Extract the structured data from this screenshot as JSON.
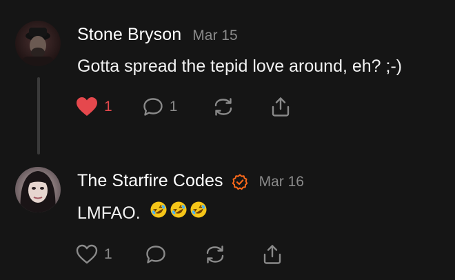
{
  "comments": [
    {
      "author": "Stone Bryson",
      "date": "Mar 15",
      "text": "Gotta spread the tepid love around, eh? ;-)",
      "liked": true,
      "like_count": "1",
      "reply_count": "1",
      "verified": false
    },
    {
      "author": "The Starfire Codes",
      "date": "Mar 16",
      "text": "LMFAO.",
      "emojis": [
        "rolling-on-floor-laughing",
        "rolling-on-floor-laughing",
        "rolling-on-floor-laughing"
      ],
      "liked": false,
      "like_count": "1",
      "reply_count": "",
      "verified": true
    }
  ],
  "colors": {
    "background": "#151515",
    "like_active": "#e5484d",
    "muted": "#8a8a8a",
    "verified_badge": "#ff6a1a"
  },
  "icons": {
    "like": "heart-icon",
    "reply": "comment-bubble-icon",
    "restack": "restack-arrows-icon",
    "share": "share-upload-icon",
    "verified": "verified-check-icon"
  }
}
